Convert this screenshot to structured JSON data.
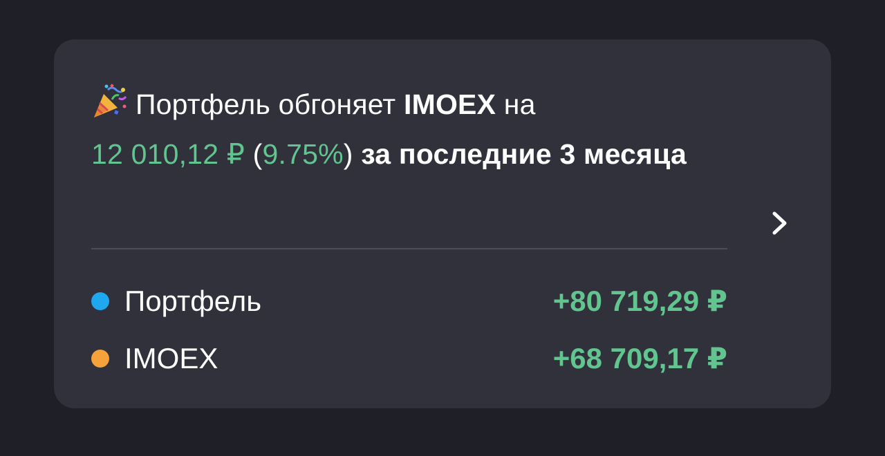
{
  "card": {
    "headline": {
      "emoji_icon": "party-popper-icon",
      "text_1": "Портфель обгоняет ",
      "index_name": "IMOEX",
      "text_2": " на",
      "diff_amount": "12 010,12 ₽",
      "percent_open": " (",
      "percent": "9.75%",
      "percent_close": ")",
      "period": " за последние 3 месяца"
    },
    "chevron_icon": "chevron-right-icon",
    "rows": [
      {
        "color": "#1ea8f0",
        "label": "Портфель",
        "value": "+80 719,29 ₽"
      },
      {
        "color": "#f5a13c",
        "label": "IMOEX",
        "value": "+68 709,17 ₽"
      }
    ]
  },
  "colors": {
    "background": "#1f2027",
    "card": "#30313b",
    "accent_green": "#62c48f",
    "text": "#ffffff"
  }
}
